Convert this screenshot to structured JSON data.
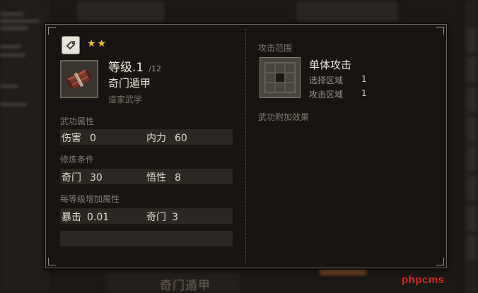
{
  "background": {
    "bottom_label": "奇门遁甲"
  },
  "watermark": "phpcms",
  "panel": {
    "type_icon": "tag-icon",
    "stars": "★★",
    "item_icon": "scroll-bundle-icon",
    "level": "等级.1",
    "max_level": "/12",
    "skill_name": "奇门遁甲",
    "school": "道家武学",
    "attributes": {
      "label": "武功属性",
      "damage_label": "伤害",
      "damage_value": "0",
      "internal_label": "内力",
      "internal_value": "60"
    },
    "requirements": {
      "label": "修炼条件",
      "qimen_label": "奇门",
      "qimen_value": "30",
      "wuxing_label": "悟性",
      "wuxing_value": "8"
    },
    "per_level": {
      "label": "每等级增加属性",
      "crit_label": "暴击",
      "crit_value": "0.01",
      "qimen_label": "奇门",
      "qimen_value": "3"
    },
    "attack_range": {
      "label": "攻击范围",
      "icon": "single-target-grid-icon",
      "name": "单体攻击",
      "select_label": "选择区域",
      "select_value": "1",
      "attack_label": "攻击区域",
      "attack_value": "1"
    },
    "extra_effects_label": "武功附加效果"
  },
  "colors": {
    "panel_bg": "#171412",
    "border": "#6f665b",
    "star": "#f0c233",
    "row_bg": "#2b2722",
    "watermark": "#d4271f"
  }
}
